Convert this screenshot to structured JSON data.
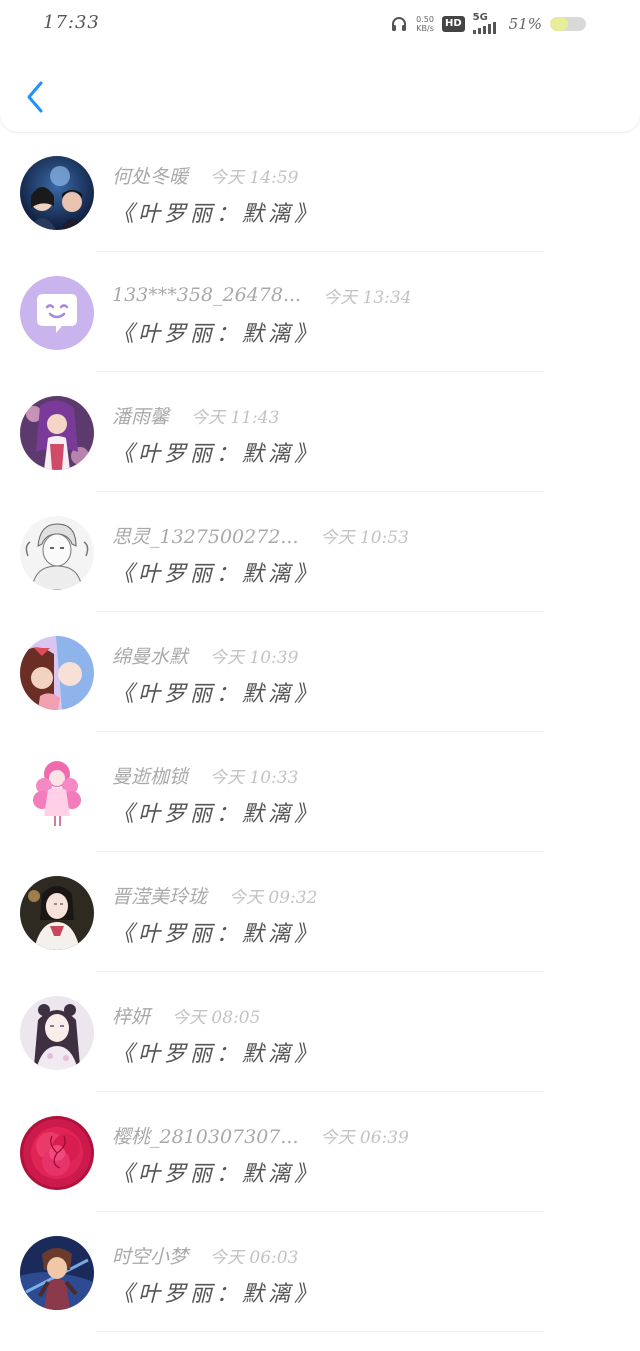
{
  "status_bar": {
    "time": "17:33",
    "net_speed_value": "0.50",
    "net_speed_unit": "KB/s",
    "hd_label": "HD",
    "network_label": "5G",
    "battery_percent": "51%",
    "battery_level": 0.51
  },
  "header": {
    "back_icon": "chevron-left-icon",
    "accent_color": "#1e90ff"
  },
  "notifications": [
    {
      "username": "何处冬暖",
      "time": "今天 14:59",
      "message": "《叶罗丽：默漓》",
      "avatar": "couple-night-avatar"
    },
    {
      "username": "133***358_26478...",
      "time": "今天 13:34",
      "message": "《叶罗丽：默漓》",
      "avatar": "default-chat-bubble-avatar"
    },
    {
      "username": "潘雨馨",
      "time": "今天 11:43",
      "message": "《叶罗丽：默漓》",
      "avatar": "purple-hair-girl-avatar"
    },
    {
      "username": "思灵_1327500272...",
      "time": "今天 10:53",
      "message": "《叶罗丽：默漓》",
      "avatar": "sketch-boy-avatar"
    },
    {
      "username": "绵曼水默",
      "time": "今天 10:39",
      "message": "《叶罗丽：默漓》",
      "avatar": "two-girls-avatar"
    },
    {
      "username": "曼逝枷锁",
      "time": "今天 10:33",
      "message": "《叶罗丽：默漓》",
      "avatar": "pink-doll-avatar"
    },
    {
      "username": "晋滢美玲珑",
      "time": "今天 09:32",
      "message": "《叶罗丽：默漓》",
      "avatar": "hanfu-lady-avatar"
    },
    {
      "username": "梓妍",
      "time": "今天 08:05",
      "message": "《叶罗丽：默漓》",
      "avatar": "anime-princess-avatar"
    },
    {
      "username": "樱桃_2810307307...",
      "time": "今天 06:39",
      "message": "《叶罗丽：默漓》",
      "avatar": "red-peony-avatar"
    },
    {
      "username": "时空小梦",
      "time": "今天 06:03",
      "message": "《叶罗丽：默漓》",
      "avatar": "game-character-avatar"
    }
  ]
}
